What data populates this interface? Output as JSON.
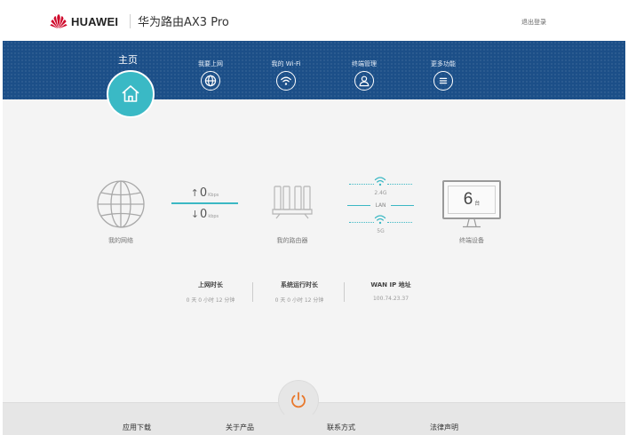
{
  "header": {
    "brand": "HUAWEI",
    "product": "华为路由AX3 Pro",
    "logout": "退出登录"
  },
  "nav": {
    "home": "主页",
    "items": [
      {
        "label": "我要上网",
        "icon": "globe-icon"
      },
      {
        "label": "我的 Wi-Fi",
        "icon": "wifi-icon"
      },
      {
        "label": "终端管理",
        "icon": "user-icon"
      },
      {
        "label": "更多功能",
        "icon": "menu-icon"
      }
    ]
  },
  "topology": {
    "network_label": "我的网络",
    "upload_value": "0",
    "upload_unit": "Kbps",
    "download_value": "0",
    "download_unit": "kbps",
    "router_label": "我的路由器",
    "band_24": "2.4G",
    "lan": "LAN",
    "band_5": "5G",
    "devices_count": "6",
    "devices_unit": "台",
    "devices_label": "终端设备"
  },
  "info": [
    {
      "title": "上网时长",
      "value": "0 天 0 小时 12 分钟"
    },
    {
      "title": "系统运行时长",
      "value": "0 天 0 小时 12 分钟"
    },
    {
      "title": "WAN IP 地址",
      "value": "100.74.23.37"
    }
  ],
  "footer": {
    "links": [
      "应用下载",
      "关于产品",
      "联系方式",
      "法律声明"
    ]
  },
  "colors": {
    "nav_bg": "#1c4f88",
    "accent": "#3ab9c5",
    "brand_red": "#cf0a2c"
  }
}
